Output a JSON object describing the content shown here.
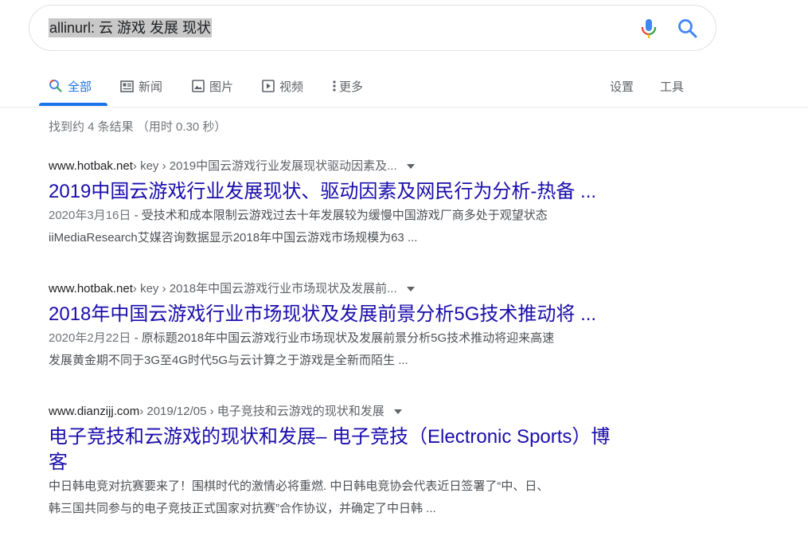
{
  "search": {
    "query": "allinurl: 云  游戏 发展 现状"
  },
  "tabs": {
    "all": "全部",
    "news": "新闻",
    "images": "图片",
    "videos": "视频",
    "more": "更多",
    "settings": "设置",
    "tools": "工具"
  },
  "stats": "找到约 4 条结果  （用时 0.30 秒）",
  "results": [
    {
      "site": "www.hotbak.net",
      "path": " › key › 2019中国云游戏行业发展现状驱动因素及...",
      "title": "2019中国云游戏行业发展现状、驱动因素及网民行为分析-热备 ...",
      "date": "2020年3月16日",
      "snippet_line1": " - 受技术和成本限制云游戏过去十年发展较为缓慢中国游戏厂商多处于观望状态",
      "snippet_line2": "iiMediaResearch艾媒咨询数据显示2018年中国云游戏市场规模为63 ..."
    },
    {
      "site": "www.hotbak.net",
      "path": " › key › 2018年中国云游戏行业市场现状及发展前...",
      "title": "2018年中国云游戏行业市场现状及发展前景分析5G技术推动将 ...",
      "date": "2020年2月22日",
      "snippet_line1": " - 原标题2018年中国云游戏行业市场现状及发展前景分析5G技术推动将迎来高速",
      "snippet_line2": "发展黄金期不同于3G至4G时代5G与云计算之于游戏是全新而陌生 ..."
    },
    {
      "site": "www.dianzijj.com",
      "path": " › 2019/12/05 › 电子竞技和云游戏的现状和发展",
      "title_line1": "电子竞技和云游戏的现状和发展– 电子竞技（Electronic Sports）博",
      "title_line2": "客",
      "snippet_line1": "中日韩电竞对抗赛要来了！围棋时代的激情必将重燃. 中日韩电竞协会代表近日签署了“中、日、",
      "snippet_line2": "韩三国共同参与的电子竞技正式国家对抗赛”合作协议，并确定了中日韩 ..."
    }
  ]
}
